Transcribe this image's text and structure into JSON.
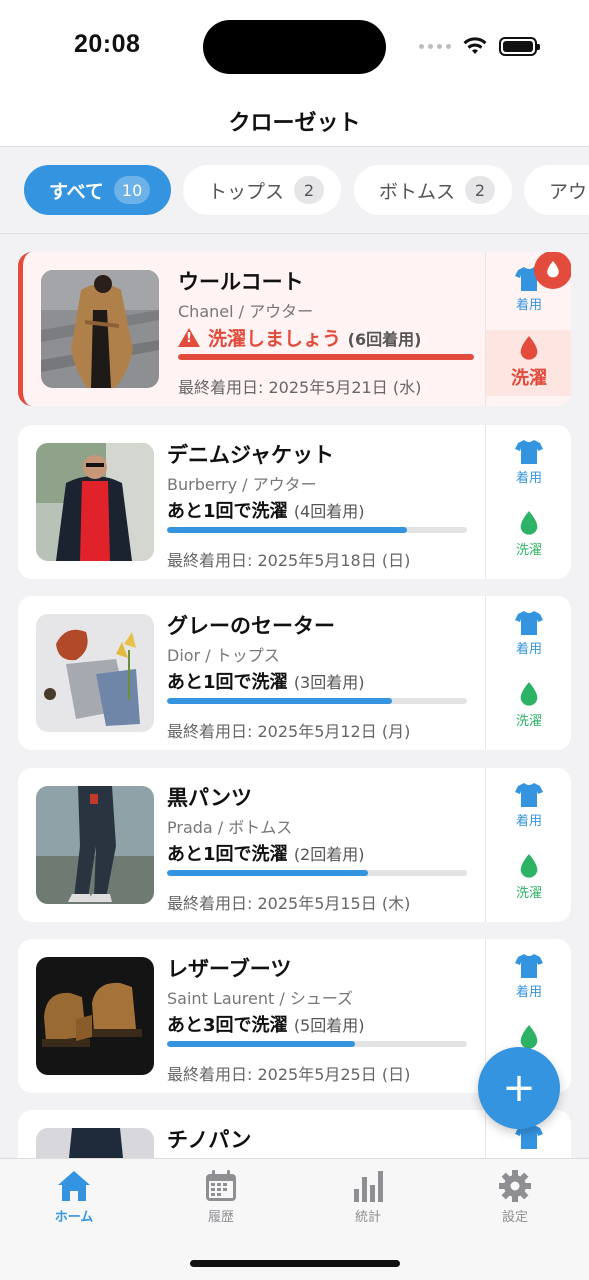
{
  "status_bar": {
    "time": "20:08"
  },
  "header": {
    "title": "クローゼット"
  },
  "filters": [
    {
      "label": "すべて",
      "count": "10",
      "active": true
    },
    {
      "label": "トップス",
      "count": "2",
      "active": false
    },
    {
      "label": "ボトムス",
      "count": "2",
      "active": false
    },
    {
      "label": "アウター",
      "count": "",
      "active": false
    }
  ],
  "items": [
    {
      "name": "ウールコート",
      "brand": "Chanel / アウター",
      "status": "洗濯しましょう",
      "uses": "(6回着用)",
      "progress": 1.0,
      "last_worn": "最終着用日: 2025年5月21日 (水)",
      "wear_label": "着用",
      "wash_label": "洗濯",
      "alert": true
    },
    {
      "name": "デニムジャケット",
      "brand": "Burberry / アウター",
      "status": "あと1回で洗濯",
      "uses": "(4回着用)",
      "progress": 0.8,
      "last_worn": "最終着用日: 2025年5月18日 (日)",
      "wear_label": "着用",
      "wash_label": "洗濯",
      "alert": false
    },
    {
      "name": "グレーのセーター",
      "brand": "Dior / トップス",
      "status": "あと1回で洗濯",
      "uses": "(3回着用)",
      "progress": 0.75,
      "last_worn": "最終着用日: 2025年5月12日 (月)",
      "wear_label": "着用",
      "wash_label": "洗濯",
      "alert": false
    },
    {
      "name": "黒パンツ",
      "brand": "Prada / ボトムス",
      "status": "あと1回で洗濯",
      "uses": "(2回着用)",
      "progress": 0.67,
      "last_worn": "最終着用日: 2025年5月15日 (木)",
      "wear_label": "着用",
      "wash_label": "洗濯",
      "alert": false
    },
    {
      "name": "レザーブーツ",
      "brand": "Saint Laurent / シューズ",
      "status": "あと3回で洗濯",
      "uses": "(5回着用)",
      "progress": 0.625,
      "last_worn": "最終着用日: 2025年5月25日 (日)",
      "wear_label": "着用",
      "wash_label": "洗濯",
      "alert": false
    },
    {
      "name": "チノパン",
      "brand": "",
      "status": "",
      "uses": "",
      "progress": 0,
      "last_worn": "",
      "wear_label": "",
      "wash_label": "",
      "alert": false
    }
  ],
  "fab": {
    "icon": "plus-icon",
    "label": "+"
  },
  "tabs": [
    {
      "label": "ホーム",
      "icon": "home-icon",
      "active": true
    },
    {
      "label": "履歴",
      "icon": "calendar-icon",
      "active": false
    },
    {
      "label": "統計",
      "icon": "bar-chart-icon",
      "active": false
    },
    {
      "label": "設定",
      "icon": "gear-icon",
      "active": false
    }
  ],
  "colors": {
    "accent": "#3494df",
    "alert": "#e34b3c",
    "wash_green": "#2db366"
  }
}
